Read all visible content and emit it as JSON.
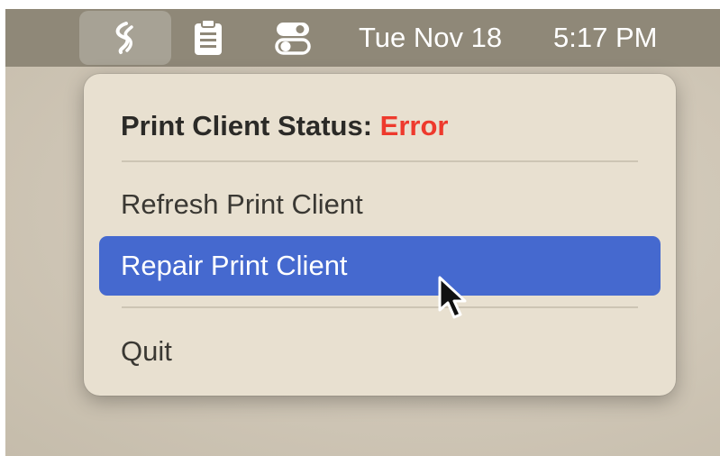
{
  "menubar": {
    "app_icon": "print-client-scribble-icon",
    "clipboard_icon": "clipboard-icon",
    "control_center_icon": "control-center-toggle-icon",
    "clock": {
      "date": "Tue Nov 18",
      "time": "5:17 PM"
    }
  },
  "menu": {
    "status_label": "Print Client Status:",
    "status_value": "Error",
    "items": [
      {
        "label": "Refresh Print Client",
        "highlighted": false
      },
      {
        "label": "Repair Print Client",
        "highlighted": true
      },
      {
        "label": "Quit",
        "highlighted": false
      }
    ]
  },
  "colors": {
    "menubar": "#8f8878",
    "menu_background": "#e8e0d0",
    "highlight": "#4569cf",
    "error": "#ee3a2d"
  },
  "cursor": "arrow-pointer-icon"
}
